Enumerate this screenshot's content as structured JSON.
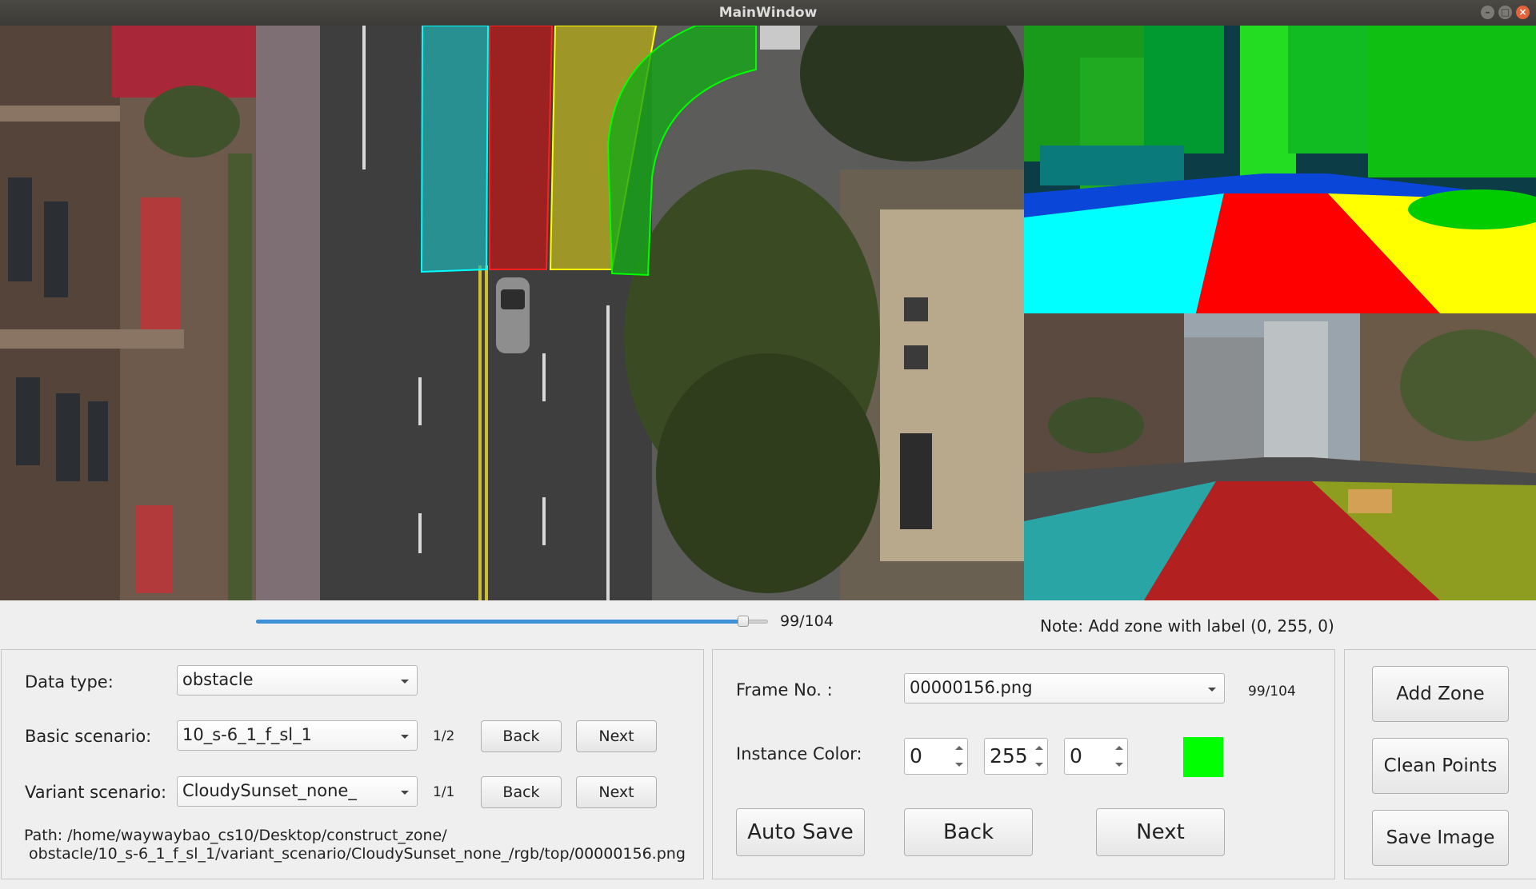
{
  "window": {
    "title": "MainWindow"
  },
  "colors": {
    "instance": "#00ff00",
    "slider_fill": "#3d8fd6"
  },
  "slider": {
    "value": 99,
    "max": 104,
    "fraction": 0.952,
    "label": "99/104"
  },
  "note": "Note: Add zone with label (0, 255, 0)",
  "data_panel": {
    "data_type_label": "Data type:",
    "data_type_value": "obstacle",
    "basic_label": "Basic scenario:",
    "basic_value": "10_s-6_1_f_sl_1",
    "basic_count": "1/2",
    "variant_label": "Variant  scenario:",
    "variant_value": "CloudySunset_none_",
    "variant_count": "1/1",
    "back_label": "Back",
    "next_label": "Next",
    "path_line1": "Path: /home/waywaybao_cs10/Desktop/construct_zone/",
    "path_line2": " obstacle/10_s-6_1_f_sl_1/variant_scenario/CloudySunset_none_/rgb/top/00000156.png"
  },
  "frame_panel": {
    "frame_label": "Frame No. :",
    "frame_value": "00000156.png",
    "frame_count": "99/104",
    "color_label": "Instance Color:",
    "r": "0",
    "g": "255",
    "b": "0",
    "auto_save": "Auto Save",
    "back": "Back",
    "next": "Next"
  },
  "actions": {
    "add_zone": "Add Zone",
    "clean_points": "Clean Points",
    "save_image": "Save Image"
  }
}
